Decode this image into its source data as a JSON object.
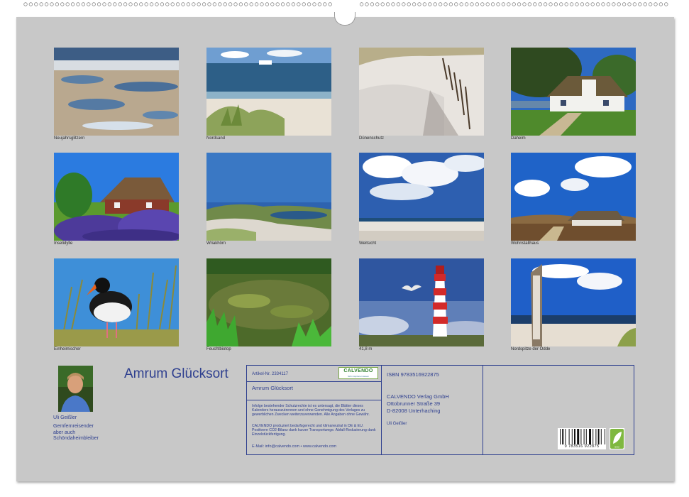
{
  "calendar": {
    "title": "Amrum Glücksort",
    "photos": [
      {
        "caption": "Neujahrsglitzern",
        "scene": "tidal-flats"
      },
      {
        "caption": "Nordsand",
        "scene": "beach-ferry"
      },
      {
        "caption": "Dünenschutz",
        "scene": "dune-fence"
      },
      {
        "caption": "Daheim",
        "scene": "thatched-house"
      },
      {
        "caption": "Inselidylle",
        "scene": "cottage-flowers"
      },
      {
        "caption": "Wriakhörn",
        "scene": "lake-dunes"
      },
      {
        "caption": "Weitsicht",
        "scene": "clouds-beach"
      },
      {
        "caption": "Wohnstallhaus",
        "scene": "heath-house"
      },
      {
        "caption": "Einheimischer",
        "scene": "oystercatcher"
      },
      {
        "caption": "Feuchtbiotop",
        "scene": "wetland"
      },
      {
        "caption": "41,8 m",
        "scene": "lighthouse"
      },
      {
        "caption": "Nordspitze der Odde",
        "scene": "signpost"
      }
    ]
  },
  "author": {
    "name": "Uli Geißler",
    "description_lines": [
      "Gernfernreisender",
      "aber auch",
      "Schöndaheimbleiber"
    ]
  },
  "info": {
    "article_number": "Artikel-Nr. 2334117",
    "product_title": "Amrum Glücksort",
    "legal_text_1": "Infolge bestehender Schutzrechte ist es untersagt, die Blätter dieses Kalenders herauszutrennen und ohne Genehmigung des Verlages zu gewerblichen Zwecken weiterzuverwenden. Alle Angaben ohne Gewähr.",
    "legal_text_2": "CALVENDO produziert bedarfsgerecht und klimaneutral in DE & EU. Positivere CO2-Bilanz dank kurzer Transportwege. Abfall-Reduzierung dank Einzelstückfertigung.",
    "contact": "E-Mail: info@calvendo.com • www.calvendo.com",
    "isbn": "ISBN 9783516922875",
    "publisher_lines": [
      "CALVENDO Verlag GmbH",
      "Ottobrunner Straße 39",
      "D-82008 Unterhaching"
    ],
    "author_credit": "Uli Geißler",
    "logo_brand": "CALVENDO",
    "logo_tagline": "Sich inspirieren lassen",
    "barcode_number": "9 783516 922875",
    "eco_label": "eco"
  },
  "colors": {
    "page_background": "#c8c8c8",
    "text_blue": "#2e3f8f",
    "caption_text": "#2b2b2b"
  }
}
